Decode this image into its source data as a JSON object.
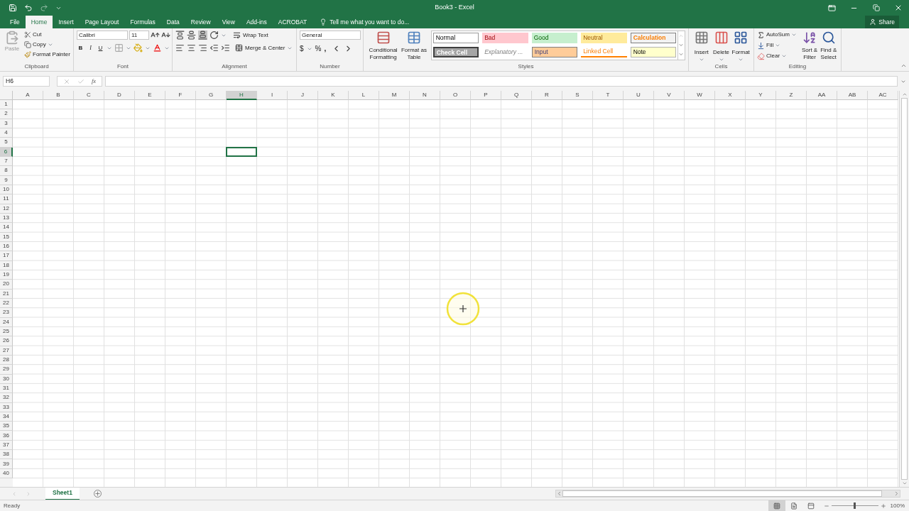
{
  "window": {
    "title": "Book3 - Excel"
  },
  "tabs": [
    {
      "label": "File",
      "selected": false
    },
    {
      "label": "Home",
      "selected": true
    },
    {
      "label": "Insert",
      "selected": false
    },
    {
      "label": "Page Layout",
      "selected": false
    },
    {
      "label": "Formulas",
      "selected": false
    },
    {
      "label": "Data",
      "selected": false
    },
    {
      "label": "Review",
      "selected": false
    },
    {
      "label": "View",
      "selected": false
    },
    {
      "label": "Add-ins",
      "selected": false
    },
    {
      "label": "ACROBAT",
      "selected": false
    }
  ],
  "tell_me": "Tell me what you want to do...",
  "share": "Share",
  "ribbon": {
    "clipboard": {
      "label": "Clipboard",
      "paste": "Paste",
      "cut": "Cut",
      "copy": "Copy",
      "format_painter": "Format Painter"
    },
    "font": {
      "label": "Font",
      "font_name": "Calibri",
      "font_size": "11",
      "bold": "B",
      "italic": "I",
      "underline": "U"
    },
    "alignment": {
      "label": "Alignment",
      "wrap_text": "Wrap Text",
      "merge": "Merge & Center"
    },
    "number": {
      "label": "Number",
      "format": "General",
      "currency": "$",
      "percent": "%",
      "comma": ","
    },
    "styles": {
      "label": "Styles",
      "conditional": [
        "Conditional",
        "Formatting"
      ],
      "format_table": [
        "Format as",
        "Table"
      ],
      "cell_styles": [
        {
          "label": "Normal",
          "kind": "normal"
        },
        {
          "label": "Bad",
          "kind": "bad"
        },
        {
          "label": "Good",
          "kind": "good"
        },
        {
          "label": "Neutral",
          "kind": "neutral"
        },
        {
          "label": "Calculation",
          "kind": "calculation"
        },
        {
          "label": "Check Cell",
          "kind": "check"
        },
        {
          "label": "Explanatory ...",
          "kind": "explanatory"
        },
        {
          "label": "Input",
          "kind": "input"
        },
        {
          "label": "Linked Cell",
          "kind": "linked"
        },
        {
          "label": "Note",
          "kind": "note"
        }
      ]
    },
    "cells": {
      "label": "Cells",
      "buttons": [
        "Insert",
        "Delete",
        "Format"
      ]
    },
    "editing": {
      "label": "Editing",
      "autosum": "AutoSum",
      "fill": "Fill",
      "clear": "Clear",
      "sort": [
        "Sort &",
        "Filter"
      ],
      "find": [
        "Find &",
        "Select"
      ]
    }
  },
  "formula_bar": {
    "name_box": "H6",
    "function_symbol": "fx"
  },
  "columns": [
    {
      "label": "A",
      "selected": false
    },
    {
      "label": "B",
      "selected": false
    },
    {
      "label": "C",
      "selected": false
    },
    {
      "label": "D",
      "selected": false
    },
    {
      "label": "E",
      "selected": false
    },
    {
      "label": "F",
      "selected": false
    },
    {
      "label": "G",
      "selected": false
    },
    {
      "label": "H",
      "selected": true
    },
    {
      "label": "I",
      "selected": false
    },
    {
      "label": "J",
      "selected": false
    },
    {
      "label": "K",
      "selected": false
    },
    {
      "label": "L",
      "selected": false
    },
    {
      "label": "M",
      "selected": false
    },
    {
      "label": "N",
      "selected": false
    },
    {
      "label": "O",
      "selected": false
    },
    {
      "label": "P",
      "selected": false
    },
    {
      "label": "Q",
      "selected": false
    },
    {
      "label": "R",
      "selected": false
    },
    {
      "label": "S",
      "selected": false
    },
    {
      "label": "T",
      "selected": false
    },
    {
      "label": "U",
      "selected": false
    },
    {
      "label": "V",
      "selected": false
    },
    {
      "label": "W",
      "selected": false
    },
    {
      "label": "X",
      "selected": false
    },
    {
      "label": "Y",
      "selected": false
    },
    {
      "label": "Z",
      "selected": false
    },
    {
      "label": "AA",
      "selected": false
    },
    {
      "label": "AB",
      "selected": false
    },
    {
      "label": "AC",
      "selected": false
    }
  ],
  "rows": [
    {
      "label": "1",
      "selected": false
    },
    {
      "label": "2",
      "selected": false
    },
    {
      "label": "3",
      "selected": false
    },
    {
      "label": "4",
      "selected": false
    },
    {
      "label": "5",
      "selected": false
    },
    {
      "label": "6",
      "selected": true
    },
    {
      "label": "7",
      "selected": false
    },
    {
      "label": "8",
      "selected": false
    },
    {
      "label": "9",
      "selected": false
    },
    {
      "label": "10",
      "selected": false
    },
    {
      "label": "11",
      "selected": false
    },
    {
      "label": "12",
      "selected": false
    },
    {
      "label": "13",
      "selected": false
    },
    {
      "label": "14",
      "selected": false
    },
    {
      "label": "15",
      "selected": false
    },
    {
      "label": "16",
      "selected": false
    },
    {
      "label": "17",
      "selected": false
    },
    {
      "label": "18",
      "selected": false
    },
    {
      "label": "19",
      "selected": false
    },
    {
      "label": "20",
      "selected": false
    },
    {
      "label": "21",
      "selected": false
    },
    {
      "label": "22",
      "selected": false
    },
    {
      "label": "23",
      "selected": false
    },
    {
      "label": "24",
      "selected": false
    },
    {
      "label": "25",
      "selected": false
    },
    {
      "label": "26",
      "selected": false
    },
    {
      "label": "27",
      "selected": false
    },
    {
      "label": "28",
      "selected": false
    },
    {
      "label": "29",
      "selected": false
    },
    {
      "label": "30",
      "selected": false
    },
    {
      "label": "31",
      "selected": false
    },
    {
      "label": "32",
      "selected": false
    },
    {
      "label": "33",
      "selected": false
    },
    {
      "label": "34",
      "selected": false
    },
    {
      "label": "35",
      "selected": false
    },
    {
      "label": "36",
      "selected": false
    },
    {
      "label": "37",
      "selected": false
    },
    {
      "label": "38",
      "selected": false
    },
    {
      "label": "39",
      "selected": false
    },
    {
      "label": "40",
      "selected": false
    }
  ],
  "sheets": [
    {
      "label": "Sheet1",
      "selected": true
    }
  ],
  "status_bar": {
    "status": "Ready",
    "zoom": "100%",
    "zoom_level": {
      "level": 0.5
    }
  }
}
